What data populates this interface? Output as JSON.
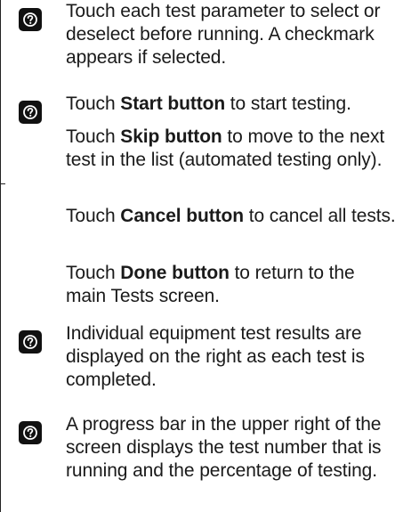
{
  "items": [
    {
      "icon": "help-icon",
      "text": "Touch each test parameter to select or deselect before running. A checkmark appears if selected."
    },
    {
      "icon": "help-icon",
      "lead": "Touch ",
      "bold": "Start button",
      "tail": " to start testing."
    },
    {
      "lead": "Touch ",
      "bold": "Skip button",
      "tail": " to move to the next test in the list (automated testing only)."
    },
    {
      "lead": "Touch ",
      "bold": "Cancel button",
      "tail": " to cancel all tests."
    },
    {
      "lead": "Touch ",
      "bold": "Done button",
      "tail": " to return to the main Tests screen."
    },
    {
      "icon": "help-icon",
      "text": "Individual equipment test results are displayed on the right as each test is completed."
    },
    {
      "icon": "help-icon",
      "text": "A progress bar in the upper right of the screen displays the test number that is running and the percentage of testing."
    }
  ]
}
